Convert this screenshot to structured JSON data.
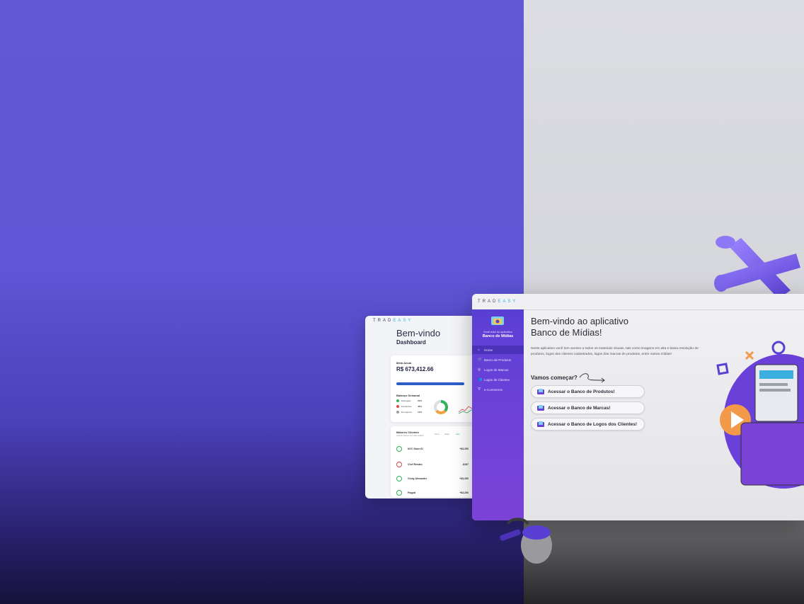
{
  "dashboard": {
    "brand_prefix": "TRAD",
    "brand_suffix": "EASY",
    "welcome": "Bem-vindo",
    "subtitle": "Dashboard",
    "meta_label": "Meta Anual",
    "meta_value": "R$ 673,412.66",
    "meta_progress": 0.9,
    "balance_label": "Balanço Semanal",
    "balance": [
      {
        "label": "Entregues",
        "pct": "20%",
        "color": "#2fb35a"
      },
      {
        "label": "Pendentes",
        "pct": "46%",
        "color": "#e04848"
      },
      {
        "label": "Em espera",
        "pct": "12%",
        "color": "#9aa0a8"
      }
    ],
    "clients_title": "Maiores Clientes",
    "clients_subtitle": "Lista de clientes com mais pedidos",
    "clients_headers": [
      "Nome",
      "Status",
      "Valor"
    ],
    "clients": [
      {
        "name": "NYC Store ID",
        "value": "+$3,250",
        "color": "#2fb35a"
      },
      {
        "name": "Chef Renato",
        "value": "-$187",
        "color": "#e04848"
      },
      {
        "name": "Cindy Alexandre",
        "value": "+$3,250",
        "color": "#2fb35a"
      },
      {
        "name": "Paypal",
        "value": "+$3,250",
        "color": "#2fb35a"
      }
    ]
  },
  "app": {
    "brand_prefix": "TRAD",
    "brand_suffix": "EASY",
    "sidebar": {
      "welcome": "Você está no aplicativo",
      "app_name": "Banco de Mídias",
      "items": [
        {
          "label": "Home",
          "icon": "home-icon",
          "glyph": "⌂",
          "active": true
        },
        {
          "label": "Banco de Produtos",
          "icon": "cart-icon",
          "glyph": "🛒",
          "active": false
        },
        {
          "label": "Logos de Marcas",
          "icon": "badge-icon",
          "glyph": "◎",
          "active": false
        },
        {
          "label": "Logos de Clientes",
          "icon": "users-icon",
          "glyph": "👥",
          "active": false
        },
        {
          "label": "e-Commerce",
          "icon": "network-icon",
          "glyph": "⛛",
          "active": false
        }
      ]
    },
    "main": {
      "title_line1": "Bem-vindo ao aplicativo",
      "title_line2": "Banco de Mídias!",
      "description": "Neste aplicativo você tem acesso a todos os materiais visuais, tais como imagens em alta e baixa resolução de produtos, logos dos clientes cadastrados, logos das marcas de produtos, entre outras mídias!",
      "start_label": "Vamos começar?",
      "actions": [
        {
          "label": "Acessar o Banco de Produtos!",
          "icon": "folder-icon"
        },
        {
          "label": "Acessar o Banco de Marcas!",
          "icon": "folder-icon"
        },
        {
          "label": "Acessar o Banco de Logos dos Clientes!",
          "icon": "folder-icon"
        }
      ]
    }
  }
}
